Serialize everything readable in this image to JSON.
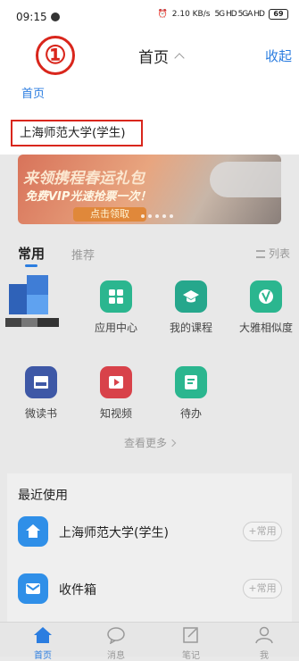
{
  "status_bar": {
    "time": "09:15",
    "network": "2.10 KB/s",
    "signal": "5G HD 5GA HD",
    "battery": "69"
  },
  "panel": {
    "annotation": "①",
    "title": "首页",
    "collapse_label": "收起",
    "home_tab": "首页",
    "account": "上海师范大学(学生)"
  },
  "banner": {
    "line1": "来领携程春运礼包",
    "line2": "免费VIP光速抢票一次！",
    "button": "点击领取"
  },
  "tabs": {
    "common": "常用",
    "recommend": "推荐",
    "list_view": "列表"
  },
  "apps": [
    {
      "label": "应用中心",
      "icon": "grid-icon"
    },
    {
      "label": "我的课程",
      "icon": "graduation-cap-icon"
    },
    {
      "label": "大雅相似度",
      "icon": "check-icon"
    },
    {
      "label": "微读书",
      "icon": "book-icon"
    },
    {
      "label": "知视频",
      "icon": "video-icon"
    },
    {
      "label": "待办",
      "icon": "todo-icon"
    }
  ],
  "see_more": "查看更多",
  "recent": {
    "heading": "最近使用",
    "items": [
      {
        "label": "上海师范大学(学生)",
        "action": "+常用",
        "icon": "home-icon"
      },
      {
        "label": "收件箱",
        "action": "+常用",
        "icon": "inbox-icon"
      }
    ]
  },
  "bottom_nav": [
    {
      "label": "首页",
      "icon": "home-icon",
      "active": true
    },
    {
      "label": "消息",
      "icon": "chat-icon",
      "active": false
    },
    {
      "label": "笔记",
      "icon": "note-icon",
      "active": false
    },
    {
      "label": "我",
      "icon": "person-icon",
      "active": false
    }
  ]
}
